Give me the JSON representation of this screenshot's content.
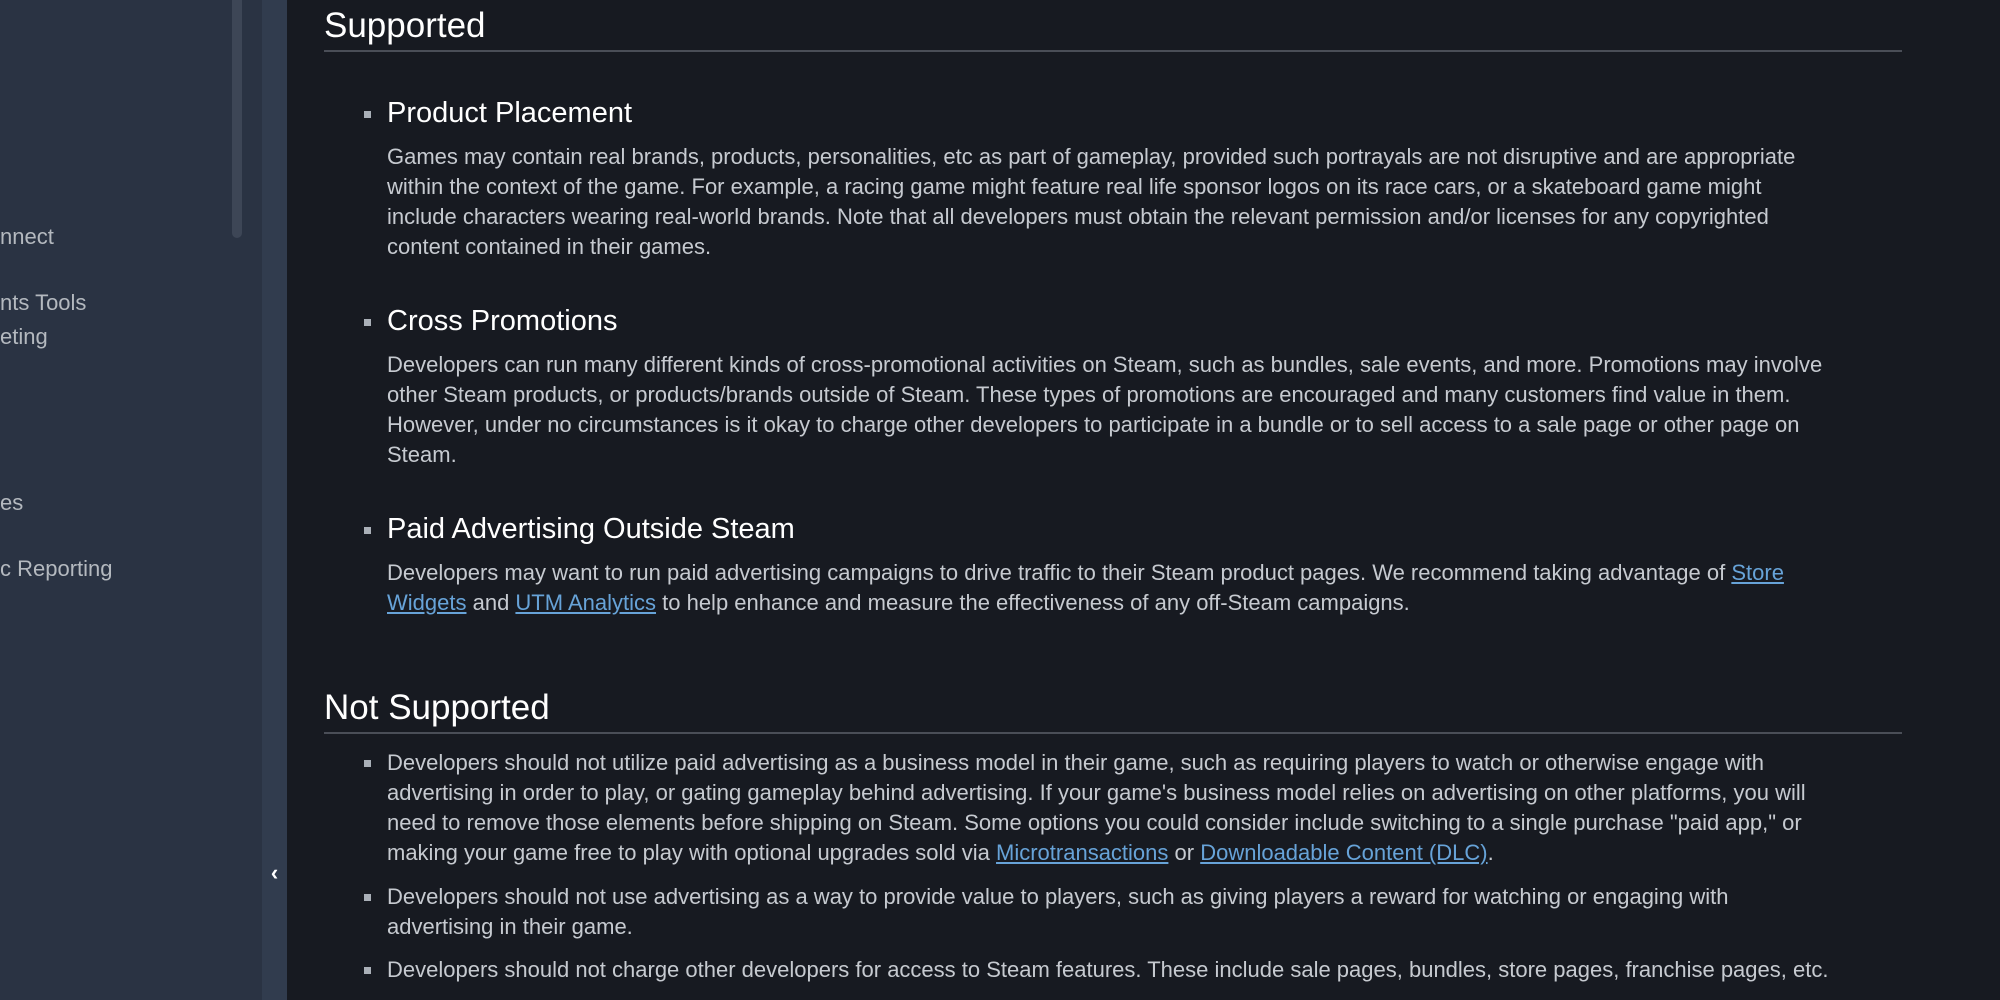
{
  "sidebar": {
    "items": [
      "nnect",
      "nts Tools",
      "eting",
      "es",
      "c Reporting"
    ]
  },
  "collapse_icon": "chevron-left-icon",
  "colors": {
    "background": "#171a21",
    "sidebar": "#2a3343",
    "link": "#67a3d8"
  },
  "supported": {
    "heading": "Supported",
    "items": [
      {
        "title": "Product Placement",
        "lines": [
          [
            {
              "t": "Games may contain real brands, products, personalities, etc as part of gameplay, provided such portrayals are not disruptive and are appropriate"
            }
          ],
          [
            {
              "t": "within the context of the game. For example, a racing game might feature real life sponsor logos on its race cars, or a skateboard game might"
            }
          ],
          [
            {
              "t": "include characters wearing real-world brands. Note that all developers must obtain the relevant permission and/or licenses for any copyrighted"
            }
          ],
          [
            {
              "t": "content contained in their games."
            }
          ]
        ]
      },
      {
        "title": "Cross Promotions",
        "lines": [
          [
            {
              "t": "Developers can run many different kinds of cross-promotional activities on Steam, such as bundles, sale events, and more. Promotions may involve"
            }
          ],
          [
            {
              "t": "other Steam products, or products/brands outside of Steam. These types of promotions are encouraged and many customers find value in them."
            }
          ],
          [
            {
              "t": "However, under no circumstances is it okay to charge other developers to participate in a bundle or to sell access to a sale page or other page on"
            }
          ],
          [
            {
              "t": "Steam."
            }
          ]
        ]
      },
      {
        "title": "Paid Advertising Outside Steam",
        "lines": [
          [
            {
              "t": "Developers may want to run paid advertising campaigns to drive traffic to their Steam product pages. We recommend taking advantage of "
            },
            {
              "t": "Store",
              "link": true
            }
          ],
          [
            {
              "t": "Widgets",
              "link": true
            },
            {
              "t": " and "
            },
            {
              "t": "UTM Analytics",
              "link": true
            },
            {
              "t": " to help enhance and measure the effectiveness of any off-Steam campaigns."
            }
          ]
        ]
      }
    ]
  },
  "not_supported": {
    "heading": "Not Supported",
    "items": [
      {
        "lines": [
          [
            {
              "t": "Developers should not utilize paid advertising as a business model in their game, such as requiring players to watch or otherwise engage with"
            }
          ],
          [
            {
              "t": "advertising in order to play, or gating gameplay behind advertising. If your game's business model relies on advertising on other platforms, you will"
            }
          ],
          [
            {
              "t": "need to remove those elements before shipping on Steam. Some options you could consider include switching to a single purchase \"paid app,\" or"
            }
          ],
          [
            {
              "t": "making your game free to play with optional upgrades sold via "
            },
            {
              "t": "Microtransactions",
              "link": true
            },
            {
              "t": " or "
            },
            {
              "t": "Downloadable Content (DLC)",
              "link": true
            },
            {
              "t": "."
            }
          ]
        ]
      },
      {
        "lines": [
          [
            {
              "t": "Developers should not use advertising as a way to provide value to players, such as giving players a reward for watching or engaging with"
            }
          ],
          [
            {
              "t": "advertising in their game."
            }
          ]
        ]
      },
      {
        "lines": [
          [
            {
              "t": "Developers should not charge other developers for access to Steam features. These include sale pages, bundles, store pages, franchise pages, etc."
            }
          ]
        ]
      }
    ]
  }
}
